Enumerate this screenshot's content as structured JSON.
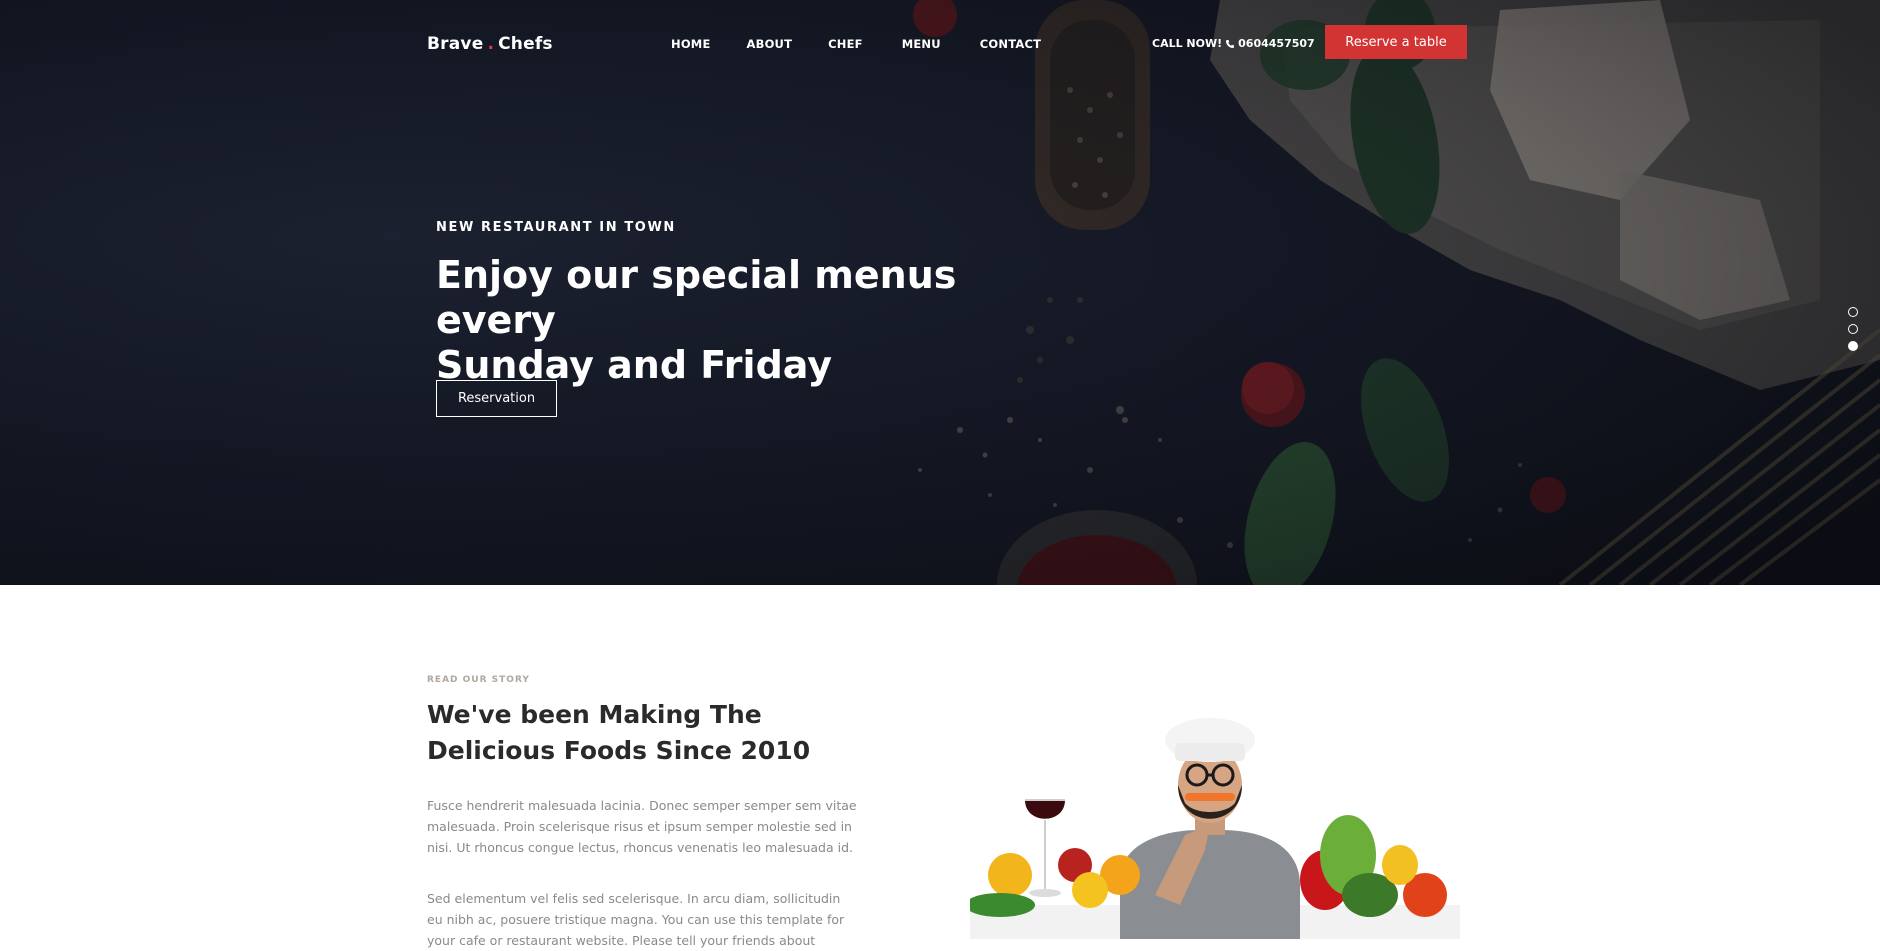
{
  "header": {
    "brand_part1": "Brave",
    "brand_dot": ".",
    "brand_part2": "Chefs",
    "nav": [
      "HOME",
      "ABOUT",
      "CHEF",
      "MENU",
      "CONTACT"
    ],
    "call_label": "CALL NOW!",
    "phone": "0604457507",
    "reserve_label": "Reserve a table"
  },
  "hero": {
    "eyebrow": "NEW RESTAURANT IN TOWN",
    "title_line1": "Enjoy our special menus every",
    "title_line2": "Sunday and Friday",
    "cta_label": "Reservation",
    "slides_count": 3,
    "active_slide": 3
  },
  "story": {
    "eyebrow": "READ OUR STORY",
    "title_line1": "We've been Making The",
    "title_line2": "Delicious Foods Since 2010",
    "paragraph1": "Fusce hendrerit malesuada lacinia. Donec semper semper sem vitae malesuada. Proin scelerisque risus et ipsum semper molestie sed in nisi. Ut rhoncus congue lectus, rhoncus venenatis leo malesuada id.",
    "paragraph2": "Sed elementum vel felis sed scelerisque. In arcu diam, sollicitudin eu nibh ac, posuere tristique magna. You can use this template for your cafe or restaurant website. Please tell your friends about"
  },
  "colors": {
    "accent": "#d23333",
    "hero_bg": "#141824",
    "eyebrow_muted": "#b0a8a0",
    "body_text": "#8a8a8a"
  },
  "icons": [
    "phone-icon"
  ]
}
